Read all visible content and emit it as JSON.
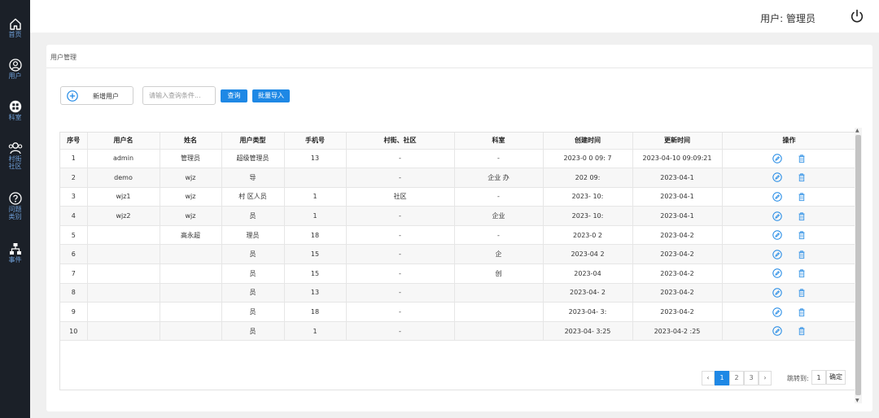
{
  "sidebar": {
    "items": [
      {
        "label": "首页",
        "icon": "home-icon"
      },
      {
        "label": "用户",
        "icon": "user-icon"
      },
      {
        "label": "科室",
        "icon": "department-icon"
      },
      {
        "label": "村街社区",
        "icon": "community-icon"
      },
      {
        "label": "问题类别",
        "icon": "question-icon"
      },
      {
        "label": "事件",
        "icon": "event-icon"
      }
    ]
  },
  "header": {
    "user_text": "用户: 管理员",
    "power_icon": "power-icon"
  },
  "page": {
    "title": "用户管理",
    "add_user_label": "新增用户",
    "search_placeholder": "请输入查询条件...",
    "query_label": "查询",
    "import_label": "批量导入"
  },
  "table": {
    "columns": [
      "序号",
      "用户名",
      "姓名",
      "用户类型",
      "手机号",
      "村街、社区",
      "科室",
      "创建时间",
      "更新时间",
      "操作"
    ],
    "rows": [
      {
        "no": "1",
        "username": "admin",
        "name": "管理员",
        "type": "超级管理员",
        "phone": "13",
        "community": "-",
        "dept": "-",
        "created": "2023-0  0 09:  7",
        "updated": "2023-04-10 09:09:21"
      },
      {
        "no": "2",
        "username": "demo",
        "name": "wjz",
        "type": "  导",
        "phone": "",
        "community": "-",
        "dept": "企业  办",
        "created": "202   09:",
        "updated": "2023-04-1"
      },
      {
        "no": "3",
        "username": "wjz1",
        "name": "wjz",
        "type": "村  区人员",
        "phone": "1",
        "community": "  社区",
        "dept": "-",
        "created": "2023-   10:",
        "updated": "2023-04-1"
      },
      {
        "no": "4",
        "username": "wjz2",
        "name": "wjz",
        "type": "员",
        "phone": "1",
        "community": "-",
        "dept": "企业",
        "created": "2023-   10:",
        "updated": "2023-04-1"
      },
      {
        "no": "5",
        "username": "",
        "name": "高永超",
        "type": "理员",
        "phone": "18",
        "community": "-",
        "dept": "-",
        "created": "2023-0  2",
        "updated": "2023-04-2"
      },
      {
        "no": "6",
        "username": "",
        "name": "",
        "type": "员",
        "phone": "15",
        "community": "-",
        "dept": "企",
        "created": "2023-04  2",
        "updated": "2023-04-2"
      },
      {
        "no": "7",
        "username": "",
        "name": "",
        "type": "员",
        "phone": "15",
        "community": "-",
        "dept": "创",
        "created": "2023-04",
        "updated": "2023-04-2"
      },
      {
        "no": "8",
        "username": "",
        "name": "",
        "type": "员",
        "phone": "13",
        "community": "-",
        "dept": "",
        "created": "2023-04-  2",
        "updated": "2023-04-2"
      },
      {
        "no": "9",
        "username": "",
        "name": "",
        "type": "员",
        "phone": "18",
        "community": "-",
        "dept": "",
        "created": "2023-04-  3:",
        "updated": "2023-04-2"
      },
      {
        "no": "10",
        "username": "",
        "name": "",
        "type": "员",
        "phone": "1",
        "community": "-",
        "dept": "",
        "created": "2023-04-  3:25",
        "updated": "2023-04-2  :25"
      }
    ]
  },
  "pagination": {
    "prev": "‹",
    "pages": [
      "1",
      "2",
      "3"
    ],
    "next": "›",
    "goto_label": "跳转到:",
    "goto_value": "1",
    "confirm_label": "确定"
  },
  "colors": {
    "sidebar_bg": "#1b2028",
    "sidebar_text": "#6f9fd8",
    "accent": "#1e88e5",
    "delete_icon": "#4a9ee8"
  }
}
